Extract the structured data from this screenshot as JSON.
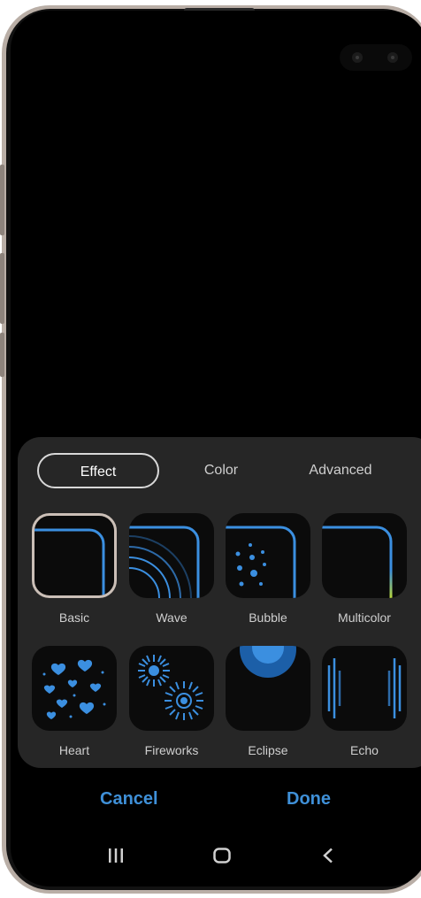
{
  "tabs": [
    {
      "label": "Effect",
      "active": true
    },
    {
      "label": "Color",
      "active": false
    },
    {
      "label": "Advanced",
      "active": false
    }
  ],
  "effects_row1": [
    {
      "label": "Basic",
      "icon": "basic-edge-icon",
      "selected": true
    },
    {
      "label": "Wave",
      "icon": "wave-edge-icon"
    },
    {
      "label": "Bubble",
      "icon": "bubble-edge-icon"
    },
    {
      "label": "Multicolor",
      "icon": "multicolor-edge-icon"
    }
  ],
  "effects_row2": [
    {
      "label": "Heart",
      "icon": "heart-edge-icon"
    },
    {
      "label": "Fireworks",
      "icon": "fireworks-edge-icon"
    },
    {
      "label": "Eclipse",
      "icon": "eclipse-edge-icon"
    },
    {
      "label": "Echo",
      "icon": "echo-edge-icon"
    }
  ],
  "actions": {
    "cancel": "Cancel",
    "done": "Done"
  },
  "colors": {
    "accent": "#3f90d8",
    "panel": "#262626",
    "edge_blue": "#3b8fe0"
  }
}
